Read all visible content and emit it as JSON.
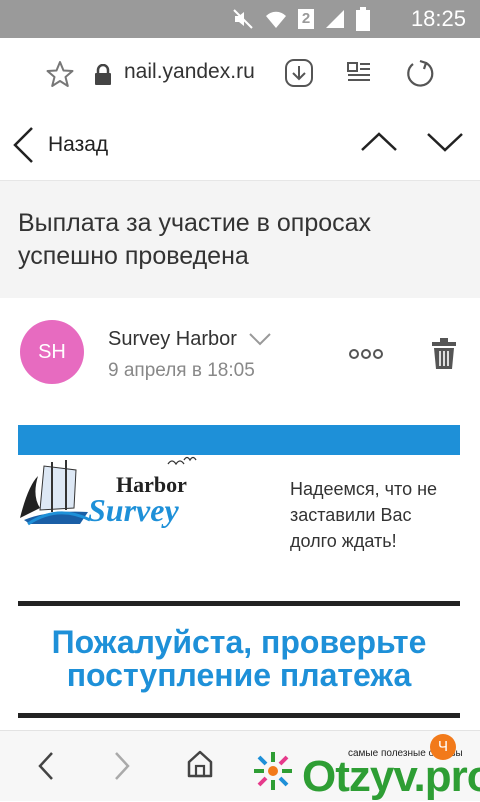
{
  "status_bar": {
    "time": "18:25",
    "sim_slot": "2"
  },
  "browser": {
    "url": "nail.yandex.ru"
  },
  "mail_nav": {
    "back_label": "Назад"
  },
  "message": {
    "subject": "Выплата за участие в опросах успешно проведена",
    "sender": {
      "initials": "SH",
      "name": "Survey Harbor",
      "date": "9 апреля в 18:05",
      "avatar_color": "#e76bc0"
    }
  },
  "email_content": {
    "logo_text_top": "Harbor",
    "logo_text_bottom": "Survey",
    "tagline": "Надеемся, что не заставили Вас долго ждать!",
    "headline": "Пожалуйста, проверьте поступление платежа",
    "accent_color": "#1e90d8"
  },
  "watermark": {
    "caption": "самые полезные отзывы",
    "brand": "Otzyv.pro",
    "badge": "Ч"
  }
}
